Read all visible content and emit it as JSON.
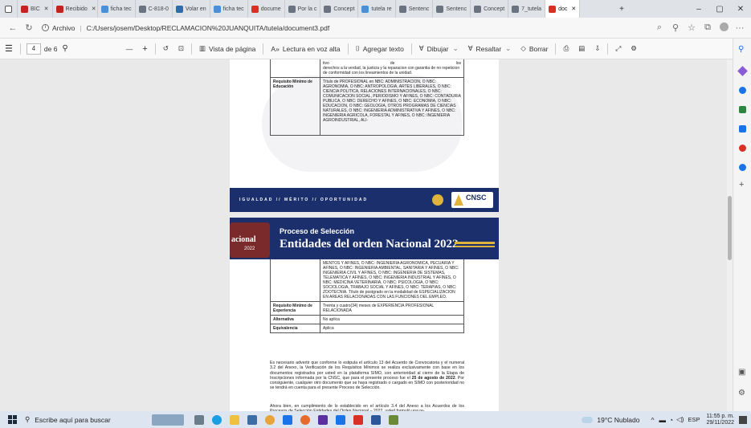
{
  "browser": {
    "tabs": [
      {
        "label": "BIC",
        "color": "#c5221f"
      },
      {
        "label": "Recibido",
        "color": "#c5221f"
      },
      {
        "label": "ficha tec",
        "color": "#4a90d9"
      },
      {
        "label": "C-818-0",
        "color": "#6b7280"
      },
      {
        "label": "Volar en",
        "color": "#2b6cb0"
      },
      {
        "label": "ficha tec",
        "color": "#4a90d9"
      },
      {
        "label": "docume",
        "color": "#d93025"
      },
      {
        "label": "Por la c",
        "color": "#6b7280"
      },
      {
        "label": "Concept",
        "color": "#6b7280"
      },
      {
        "label": "tutela re",
        "color": "#4a90d9"
      },
      {
        "label": "Sentenc",
        "color": "#6b7280"
      },
      {
        "label": "Sentenc",
        "color": "#6b7280"
      },
      {
        "label": "Concept",
        "color": "#6b7280"
      },
      {
        "label": "7_tutela",
        "color": "#6b7280"
      },
      {
        "label": "doc",
        "color": "#d93025",
        "active": true
      }
    ],
    "address_prefix": "Archivo",
    "url": "C:/Users/josem/Desktop/RECLAMACION%20JUANQUITA/tutela/document3.pdf"
  },
  "pdf_toolbar": {
    "page_current": "4",
    "page_total": "de 6",
    "minus": "—",
    "plus": "+",
    "page_view": "Vista de página",
    "read_aloud": "Lectura en voz alta",
    "add_text": "Agregar texto",
    "draw": "Dibujar",
    "highlight": "Resaltar",
    "erase": "Borrar"
  },
  "page1": {
    "top_row_cells": [
      "tivo",
      "de",
      "los"
    ],
    "top_row_text": "derechos a la verdad, la justicia y la reparacion con garantia de no repeticion de conformidad con los lineamientos de la unidad.",
    "edu_label": "Requisito Mínimo de Educación",
    "edu_text": "Título de PROFESIONAL en NBC: ADMINISTRACION, O NBC: AGRONOMIA, O NBC: ANTROPOLOGIA, ARTES LIBERALES, O NBC: CIENCIA POLITICA, RELACIONES INTERNACIONALES, O NBC: COMUNICACION SOCIAL, PERIODISMO Y AFINES, O NBC: CONTADURIA PUBLICA, O NBC: DERECHO Y AFINES, O NBC: ECONOMIA, O NBC: EDUCACION, O NBC: GEOLOGIA, OTROS PROGRAMAS DE CIENCIAS NATURALES, O NBC: INGENIERIA ADMINISTRATIVA Y AFINES, O NBC: INGENIERIA AGRICOLA, FORESTAL Y AFINES, O NBC: INGENIERIA AGROINDUSTRIAL, ALI-",
    "footer_motto": "IGUALDAD  //  MÉRITO  //  OPORTUNIDAD",
    "footer_logo": "CNSC"
  },
  "page2": {
    "banner_small": "Proceso de Selección",
    "banner_big": "Entidades del orden Nacional 2022",
    "badge_text": "acional",
    "badge_year": "2022",
    "cont_text": "MENTOS Y AFINES, O NBC: INGENIERIA AGRONOMICA, PECUARIA Y AFINES, O NBC: INGENIERIA AMBIENTAL, SANITARIA Y AFINES, O NBC: INGENIERIA CIVIL Y AFINES, O NBC: INGENIERIA DE SISTEMAS, TELEMATICA Y AFINES, O NBC: INGENIERIA INDUSTRIAL Y AFINES, O NBC: MEDICINA VETERINARIA, O NBC: PSICOLOGIA, O NBC: SOCIOLOGIA, TRABAJO SOCIAL Y AFINES, O NBC: TERAPIAS, O NBC: ZOOTECNIA. Título de postgrado en la modalidad de ESPECIALIZACION EN AREAS RELACIONADAS CON LAS FUNCIONES DEL EMPLEO.",
    "exp_label": "Requisito Mínimo de Experiencia",
    "exp_text": "Treinta y cuatro(34) meses de EXPERIENCIA PROFESIONAL RELACIONADA",
    "alt_label": "Alternativa",
    "alt_text": "No aplica",
    "eq_label": "Equivalencia",
    "eq_text": "Aplica",
    "para1_a": "Es necesario advertir que conforme lo estipula el artículo 13 del Acuerdo de Convocatoria y el numeral 3.2 del Anexo, la Verificación de los Requisitos Mínimos se realiza exclusivamente con base en los documentos registrados por usted en la plataforma SIMO, con anterioridad al cierre de la Etapa de Inscripciones informada por la CNSC, que para el presente proceso fue el ",
    "para1_bold": "25 de agosto de 2022",
    "para1_b": ". Por consiguiente, cualquier otro documento que se haya registrado o cargado en SIMO con posterioridad no se tendrá en cuenta para el presente Proceso de Selección.",
    "para2": "Ahora bien, en cumplimiento de lo establecido en el artículo 3.4 del Anexo a los Acuerdos de los Procesos de Selección Entidades del Orden Nacional – 2022, usted formuló una re-"
  },
  "taskbar": {
    "search_placeholder": "Escribe aquí para buscar",
    "weather": "19°C  Nublado",
    "lang": "ESP",
    "time": "11:55 p. m.",
    "date": "29/11/2022"
  },
  "colors": {
    "banner_bg": "#1a2f6b",
    "banner_stripe": "#e0b43a",
    "accent_edge": "#1b73e8"
  }
}
